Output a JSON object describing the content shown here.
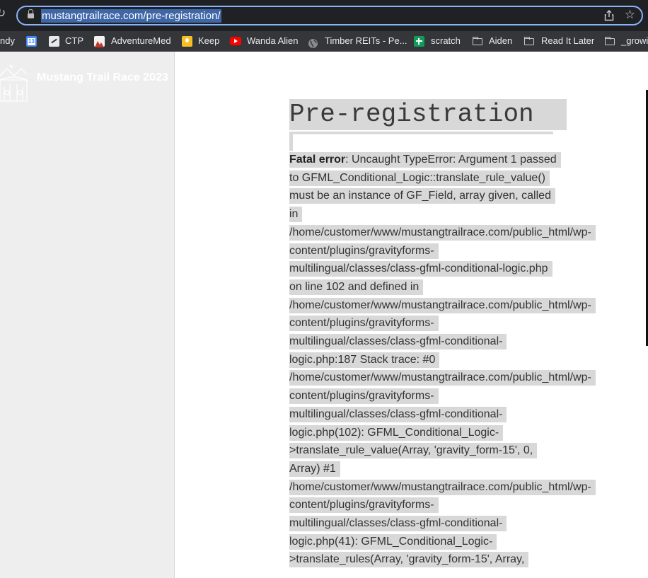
{
  "browser": {
    "url": "mustangtrailrace.com/pre-registration/",
    "icons": {
      "reload": "reload-icon",
      "lock": "lock-icon",
      "share": "share-icon",
      "bookmark_star": "star-icon"
    },
    "bookmarks": [
      {
        "label": "ndy",
        "icon": "none"
      },
      {
        "label": "",
        "icon": "calendar-icon",
        "badge": "13"
      },
      {
        "label": "CTP",
        "icon": "ctp-icon"
      },
      {
        "label": "AdventureMed",
        "icon": "adventuremed-icon"
      },
      {
        "label": "Keep",
        "icon": "keep-icon"
      },
      {
        "label": "Wanda Alien",
        "icon": "youtube-icon"
      },
      {
        "label": "Timber REITs - Pe...",
        "icon": "globe-icon"
      },
      {
        "label": "scratch",
        "icon": "sheets-icon"
      },
      {
        "label": "Aiden",
        "icon": "folder-icon"
      },
      {
        "label": "Read It Later",
        "icon": "folder-icon"
      },
      {
        "label": "_growi",
        "icon": "folder-icon"
      }
    ]
  },
  "site": {
    "title": "Mustang Trail Race 2023",
    "logo_icon": "mustang-trail-race-logo"
  },
  "page": {
    "title": "Pre-registration",
    "error_label": "Fatal error",
    "error_message": ": Uncaught TypeError: Argument 1 passed to GFML_Conditional_Logic::translate_rule_value() must be an instance of GF_Field, array given, called in /home/customer/www/mustangtrailrace.com/public_html/wp-content/plugins/gravityforms-multilingual/classes/class-gfml-conditional-logic.php on line 102 and defined in /home/customer/www/mustangtrailrace.com/public_html/wp-content/plugins/gravityforms-multilingual/classes/class-gfml-conditional-logic.php:187 Stack trace: #0 /home/customer/www/mustangtrailrace.com/public_html/wp-content/plugins/gravityforms-multilingual/classes/class-gfml-conditional-logic.php(102): GFML_Conditional_Logic->translate_rule_value(Array, 'gravity_form-15', 0, Array) #1 /home/customer/www/mustangtrailrace.com/public_html/wp-content/plugins/gravityforms-multilingual/classes/class-gfml-conditional-logic.php(41): GFML_Conditional_Logic->translate_rules(Array, 'gravity_form-15', Array,"
  }
}
